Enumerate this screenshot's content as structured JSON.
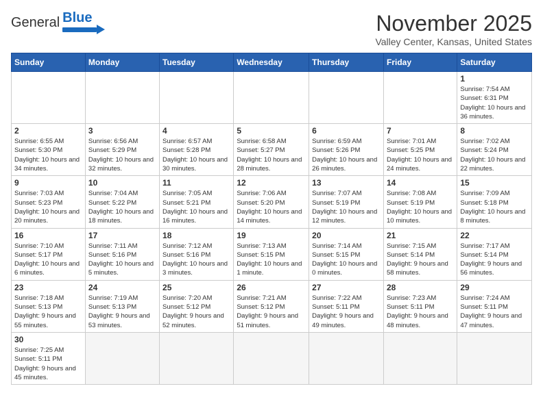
{
  "header": {
    "logo_general": "General",
    "logo_blue": "Blue",
    "month_title": "November 2025",
    "location": "Valley Center, Kansas, United States"
  },
  "weekdays": [
    "Sunday",
    "Monday",
    "Tuesday",
    "Wednesday",
    "Thursday",
    "Friday",
    "Saturday"
  ],
  "weeks": [
    [
      {
        "day": "",
        "info": ""
      },
      {
        "day": "",
        "info": ""
      },
      {
        "day": "",
        "info": ""
      },
      {
        "day": "",
        "info": ""
      },
      {
        "day": "",
        "info": ""
      },
      {
        "day": "",
        "info": ""
      },
      {
        "day": "1",
        "info": "Sunrise: 7:54 AM\nSunset: 6:31 PM\nDaylight: 10 hours and 36 minutes."
      }
    ],
    [
      {
        "day": "2",
        "info": "Sunrise: 6:55 AM\nSunset: 5:30 PM\nDaylight: 10 hours and 34 minutes."
      },
      {
        "day": "3",
        "info": "Sunrise: 6:56 AM\nSunset: 5:29 PM\nDaylight: 10 hours and 32 minutes."
      },
      {
        "day": "4",
        "info": "Sunrise: 6:57 AM\nSunset: 5:28 PM\nDaylight: 10 hours and 30 minutes."
      },
      {
        "day": "5",
        "info": "Sunrise: 6:58 AM\nSunset: 5:27 PM\nDaylight: 10 hours and 28 minutes."
      },
      {
        "day": "6",
        "info": "Sunrise: 6:59 AM\nSunset: 5:26 PM\nDaylight: 10 hours and 26 minutes."
      },
      {
        "day": "7",
        "info": "Sunrise: 7:01 AM\nSunset: 5:25 PM\nDaylight: 10 hours and 24 minutes."
      },
      {
        "day": "8",
        "info": "Sunrise: 7:02 AM\nSunset: 5:24 PM\nDaylight: 10 hours and 22 minutes."
      }
    ],
    [
      {
        "day": "9",
        "info": "Sunrise: 7:03 AM\nSunset: 5:23 PM\nDaylight: 10 hours and 20 minutes."
      },
      {
        "day": "10",
        "info": "Sunrise: 7:04 AM\nSunset: 5:22 PM\nDaylight: 10 hours and 18 minutes."
      },
      {
        "day": "11",
        "info": "Sunrise: 7:05 AM\nSunset: 5:21 PM\nDaylight: 10 hours and 16 minutes."
      },
      {
        "day": "12",
        "info": "Sunrise: 7:06 AM\nSunset: 5:20 PM\nDaylight: 10 hours and 14 minutes."
      },
      {
        "day": "13",
        "info": "Sunrise: 7:07 AM\nSunset: 5:19 PM\nDaylight: 10 hours and 12 minutes."
      },
      {
        "day": "14",
        "info": "Sunrise: 7:08 AM\nSunset: 5:19 PM\nDaylight: 10 hours and 10 minutes."
      },
      {
        "day": "15",
        "info": "Sunrise: 7:09 AM\nSunset: 5:18 PM\nDaylight: 10 hours and 8 minutes."
      }
    ],
    [
      {
        "day": "16",
        "info": "Sunrise: 7:10 AM\nSunset: 5:17 PM\nDaylight: 10 hours and 6 minutes."
      },
      {
        "day": "17",
        "info": "Sunrise: 7:11 AM\nSunset: 5:16 PM\nDaylight: 10 hours and 5 minutes."
      },
      {
        "day": "18",
        "info": "Sunrise: 7:12 AM\nSunset: 5:16 PM\nDaylight: 10 hours and 3 minutes."
      },
      {
        "day": "19",
        "info": "Sunrise: 7:13 AM\nSunset: 5:15 PM\nDaylight: 10 hours and 1 minute."
      },
      {
        "day": "20",
        "info": "Sunrise: 7:14 AM\nSunset: 5:15 PM\nDaylight: 10 hours and 0 minutes."
      },
      {
        "day": "21",
        "info": "Sunrise: 7:15 AM\nSunset: 5:14 PM\nDaylight: 9 hours and 58 minutes."
      },
      {
        "day": "22",
        "info": "Sunrise: 7:17 AM\nSunset: 5:14 PM\nDaylight: 9 hours and 56 minutes."
      }
    ],
    [
      {
        "day": "23",
        "info": "Sunrise: 7:18 AM\nSunset: 5:13 PM\nDaylight: 9 hours and 55 minutes."
      },
      {
        "day": "24",
        "info": "Sunrise: 7:19 AM\nSunset: 5:13 PM\nDaylight: 9 hours and 53 minutes."
      },
      {
        "day": "25",
        "info": "Sunrise: 7:20 AM\nSunset: 5:12 PM\nDaylight: 9 hours and 52 minutes."
      },
      {
        "day": "26",
        "info": "Sunrise: 7:21 AM\nSunset: 5:12 PM\nDaylight: 9 hours and 51 minutes."
      },
      {
        "day": "27",
        "info": "Sunrise: 7:22 AM\nSunset: 5:11 PM\nDaylight: 9 hours and 49 minutes."
      },
      {
        "day": "28",
        "info": "Sunrise: 7:23 AM\nSunset: 5:11 PM\nDaylight: 9 hours and 48 minutes."
      },
      {
        "day": "29",
        "info": "Sunrise: 7:24 AM\nSunset: 5:11 PM\nDaylight: 9 hours and 47 minutes."
      }
    ],
    [
      {
        "day": "30",
        "info": "Sunrise: 7:25 AM\nSunset: 5:11 PM\nDaylight: 9 hours and 45 minutes."
      },
      {
        "day": "",
        "info": ""
      },
      {
        "day": "",
        "info": ""
      },
      {
        "day": "",
        "info": ""
      },
      {
        "day": "",
        "info": ""
      },
      {
        "day": "",
        "info": ""
      },
      {
        "day": "",
        "info": ""
      }
    ]
  ]
}
